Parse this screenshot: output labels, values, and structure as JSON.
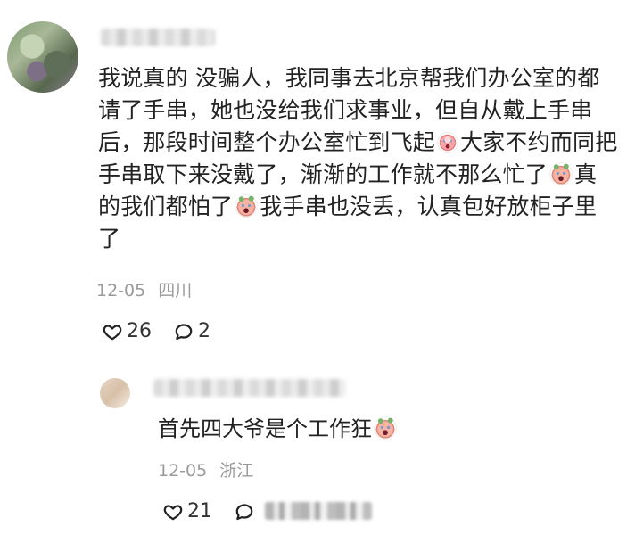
{
  "comment": {
    "text_before_1": "我说真的 没骗人，我同事去北京帮我们办公室的都请了手串，她也没给我们求事业，但自从戴上手串后，那段时间整个办公室忙到飞起",
    "text_after_1": "大家不约而同把手串取下来没戴了，渐渐的工作就不那么忙了",
    "text_after_2": "真的我们都怕了",
    "text_after_3": "我手串也没丢，认真包好放柜子里了",
    "date": "12-05",
    "location": "四川",
    "likes": "26",
    "replies": "2"
  },
  "reply": {
    "text": "首先四大爷是个工作狂",
    "date": "12-05",
    "location": "浙江",
    "likes": "21"
  },
  "icons": {
    "heart": "heart-icon",
    "comment": "comment-icon",
    "emoji": "emoji-icon"
  }
}
